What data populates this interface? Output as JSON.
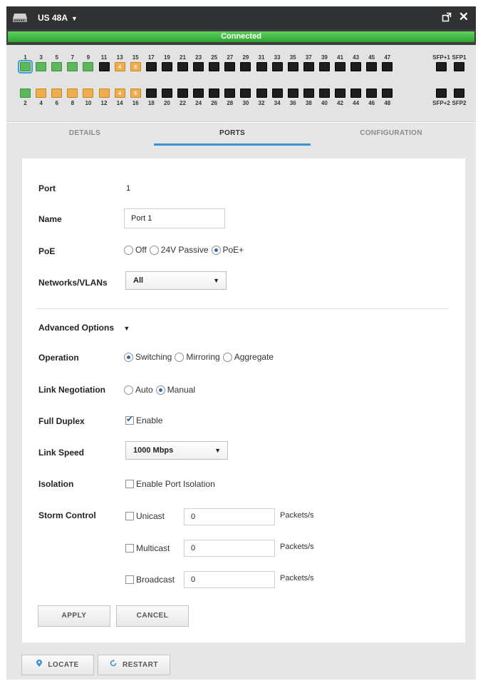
{
  "titlebar": {
    "device_name": "US 48A"
  },
  "status": "Connected",
  "ports": {
    "top_row": [
      {
        "num": "1",
        "state": "green",
        "label": ""
      },
      {
        "num": "3",
        "state": "green",
        "label": ""
      },
      {
        "num": "5",
        "state": "green",
        "label": ""
      },
      {
        "num": "7",
        "state": "green",
        "label": ""
      },
      {
        "num": "9",
        "state": "green",
        "label": ""
      },
      {
        "num": "11",
        "state": "black",
        "label": ""
      },
      {
        "num": "13",
        "state": "orange",
        "label": "4"
      },
      {
        "num": "15",
        "state": "orange",
        "label": "5"
      },
      {
        "num": "17",
        "state": "black",
        "label": ""
      },
      {
        "num": "19",
        "state": "black",
        "label": ""
      },
      {
        "num": "21",
        "state": "black",
        "label": ""
      },
      {
        "num": "23",
        "state": "black",
        "label": ""
      },
      {
        "num": "25",
        "state": "black",
        "label": ""
      },
      {
        "num": "27",
        "state": "black",
        "label": ""
      },
      {
        "num": "29",
        "state": "black",
        "label": ""
      },
      {
        "num": "31",
        "state": "black",
        "label": ""
      },
      {
        "num": "33",
        "state": "black",
        "label": ""
      },
      {
        "num": "35",
        "state": "black",
        "label": ""
      },
      {
        "num": "37",
        "state": "black",
        "label": ""
      },
      {
        "num": "39",
        "state": "black",
        "label": ""
      },
      {
        "num": "41",
        "state": "black",
        "label": ""
      },
      {
        "num": "43",
        "state": "black",
        "label": ""
      },
      {
        "num": "45",
        "state": "black",
        "label": ""
      },
      {
        "num": "47",
        "state": "black",
        "label": ""
      }
    ],
    "bottom_row": [
      {
        "num": "2",
        "state": "green",
        "label": ""
      },
      {
        "num": "4",
        "state": "orange",
        "label": ""
      },
      {
        "num": "6",
        "state": "orange",
        "label": ""
      },
      {
        "num": "8",
        "state": "orange",
        "label": ""
      },
      {
        "num": "10",
        "state": "orange",
        "label": ""
      },
      {
        "num": "12",
        "state": "orange",
        "label": ""
      },
      {
        "num": "14",
        "state": "orange",
        "label": "4"
      },
      {
        "num": "16",
        "state": "orange",
        "label": "5"
      },
      {
        "num": "18",
        "state": "black",
        "label": ""
      },
      {
        "num": "20",
        "state": "black",
        "label": ""
      },
      {
        "num": "22",
        "state": "black",
        "label": ""
      },
      {
        "num": "24",
        "state": "black",
        "label": ""
      },
      {
        "num": "26",
        "state": "black",
        "label": ""
      },
      {
        "num": "28",
        "state": "black",
        "label": ""
      },
      {
        "num": "30",
        "state": "black",
        "label": ""
      },
      {
        "num": "32",
        "state": "black",
        "label": ""
      },
      {
        "num": "34",
        "state": "black",
        "label": ""
      },
      {
        "num": "36",
        "state": "black",
        "label": ""
      },
      {
        "num": "38",
        "state": "black",
        "label": ""
      },
      {
        "num": "40",
        "state": "black",
        "label": ""
      },
      {
        "num": "42",
        "state": "black",
        "label": ""
      },
      {
        "num": "44",
        "state": "black",
        "label": ""
      },
      {
        "num": "46",
        "state": "black",
        "label": ""
      },
      {
        "num": "48",
        "state": "black",
        "label": ""
      }
    ],
    "sfp_top": [
      {
        "num": "SFP+1",
        "state": "black"
      },
      {
        "num": "SFP1",
        "state": "black"
      }
    ],
    "sfp_bottom": [
      {
        "num": "SFP+2",
        "state": "black"
      },
      {
        "num": "SFP2",
        "state": "black"
      }
    ],
    "selected": "1"
  },
  "tabs": [
    {
      "label": "DETAILS",
      "active": false
    },
    {
      "label": "PORTS",
      "active": true
    },
    {
      "label": "CONFIGURATION",
      "active": false
    }
  ],
  "form": {
    "port_label": "Port",
    "port_value": "1",
    "name_label": "Name",
    "name_value": "Port 1",
    "poe_label": "PoE",
    "poe_options": [
      "Off",
      "24V Passive",
      "PoE+"
    ],
    "poe_selected": "PoE+",
    "networks_label": "Networks/VLANs",
    "networks_value": "All",
    "advanced_label": "Advanced Options",
    "operation_label": "Operation",
    "operation_options": [
      "Switching",
      "Mirroring",
      "Aggregate"
    ],
    "operation_selected": "Switching",
    "link_negotiation_label": "Link Negotiation",
    "link_negotiation_options": [
      "Auto",
      "Manual"
    ],
    "link_negotiation_selected": "Manual",
    "full_duplex_label": "Full Duplex",
    "full_duplex_option": "Enable",
    "full_duplex_checked": true,
    "link_speed_label": "Link Speed",
    "link_speed_value": "1000 Mbps",
    "isolation_label": "Isolation",
    "isolation_option": "Enable Port Isolation",
    "isolation_checked": false,
    "storm_control_label": "Storm Control",
    "storm": [
      {
        "label": "Unicast",
        "value": "0",
        "unit": "Packets/s"
      },
      {
        "label": "Multicast",
        "value": "0",
        "unit": "Packets/s"
      },
      {
        "label": "Broadcast",
        "value": "0",
        "unit": "Packets/s"
      }
    ],
    "apply_label": "APPLY",
    "cancel_label": "CANCEL"
  },
  "footer": {
    "locate_label": "LOCATE",
    "restart_label": "RESTART"
  },
  "colors": {
    "accent": "#3d93d0",
    "connected": "#3cb43c",
    "port_active": "#5cb85c",
    "port_poe": "#f0ad4e",
    "port_down": "#1e1e1e"
  }
}
